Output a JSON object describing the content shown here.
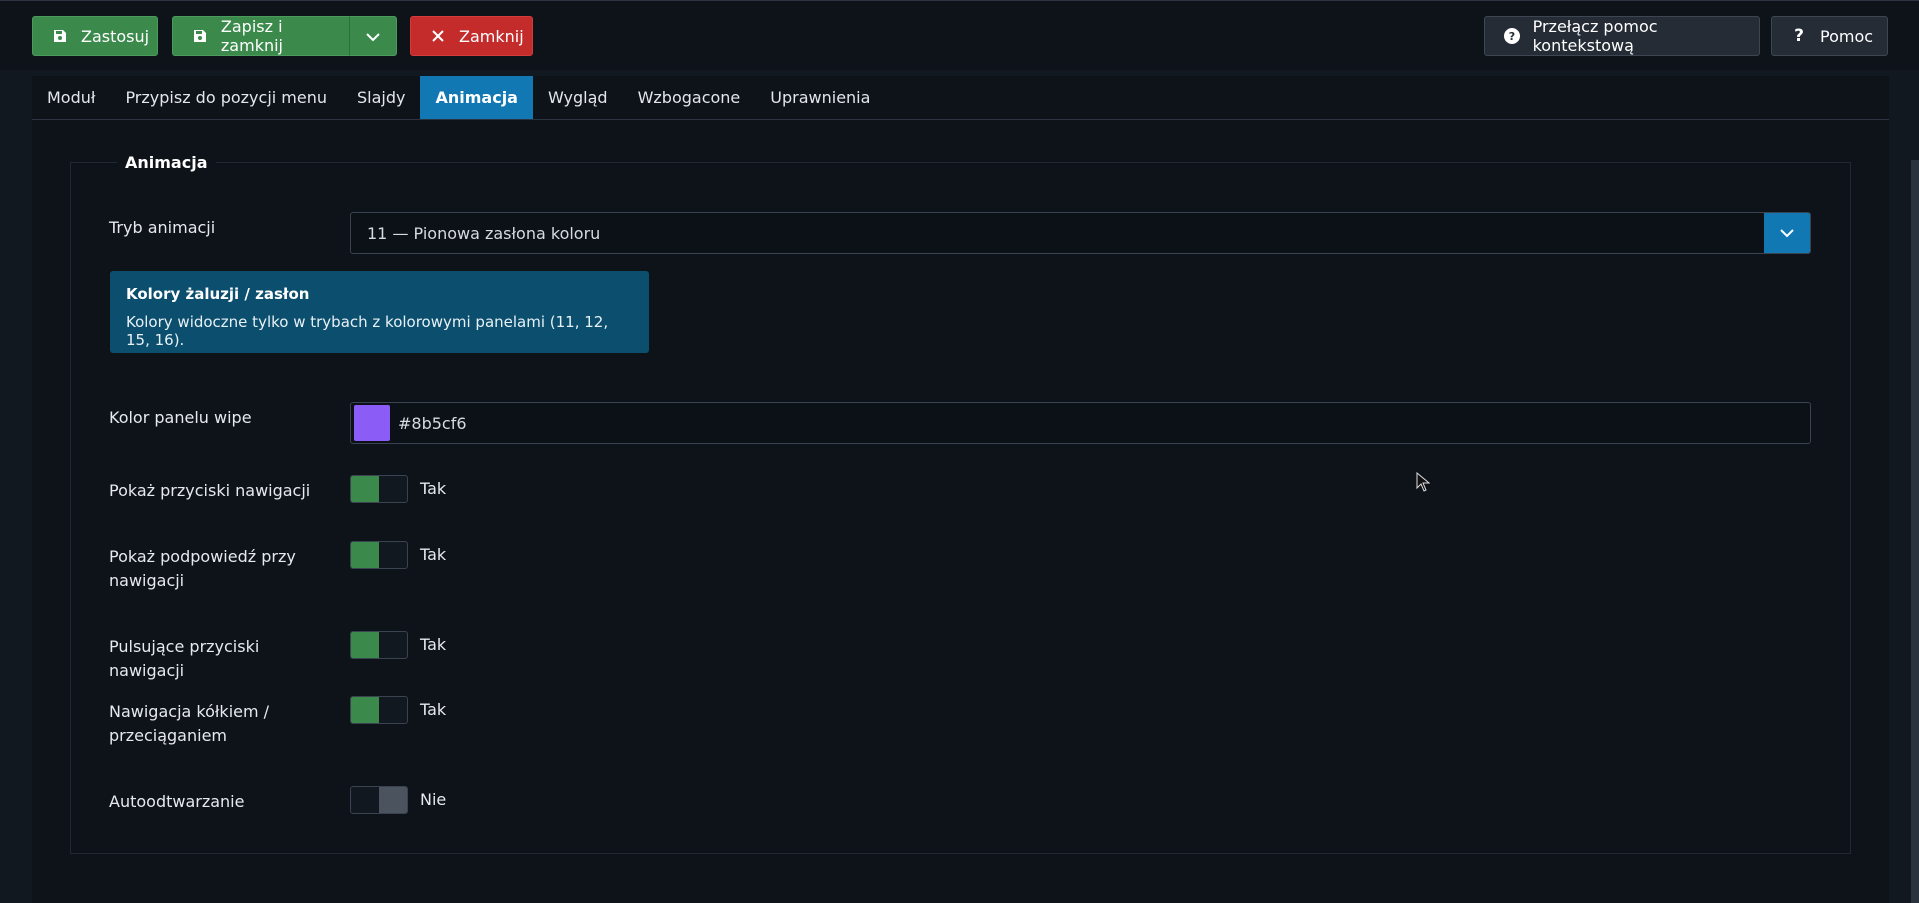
{
  "toolbar": {
    "apply_label": "Zastosuj",
    "save_close_label": "Zapisz i zamknij",
    "close_label": "Zamknij",
    "toggle_help_label": "Przełącz pomoc kontekstową",
    "help_label": "Pomoc"
  },
  "tabs": [
    {
      "label": "Moduł"
    },
    {
      "label": "Przypisz do pozycji menu"
    },
    {
      "label": "Slajdy"
    },
    {
      "label": "Animacja",
      "active": true
    },
    {
      "label": "Wygląd"
    },
    {
      "label": "Wzbogacone"
    },
    {
      "label": "Uprawnienia"
    }
  ],
  "fieldset": {
    "legend": "Animacja",
    "animation_mode": {
      "label": "Tryb animacji",
      "value": "11 — Pionowa zasłona koloru"
    },
    "alert": {
      "heading": "Kolory żaluzji / zasłon",
      "text": "Kolory widoczne tylko w trybach z kolorowymi panelami (11, 12, 15, 16)."
    },
    "wipe_color": {
      "label": "Kolor panelu wipe",
      "value": "#8b5cf6",
      "swatch": "#8b5cf6"
    },
    "switches": [
      {
        "label": "Pokaż przyciski nawigacji",
        "state": "Tak",
        "on": true
      },
      {
        "label": "Pokaż podpowiedź przy nawigacji",
        "state": "Tak",
        "on": true
      },
      {
        "label": "Pulsujące przyciski nawigacji",
        "state": "Tak",
        "on": true
      },
      {
        "label": "Nawigacja kółkiem / przeciąganiem",
        "state": "Tak",
        "on": true
      },
      {
        "label": "Autoodtwarzanie",
        "state": "Nie",
        "on": false
      }
    ]
  },
  "colors": {
    "success": "#3b8a4c",
    "danger": "#c42b2b",
    "primary": "#1178b3",
    "info_bg": "#0b4e6e"
  },
  "icons": {
    "apply": "save-icon",
    "save_close": "save-icon",
    "dropdown": "chevron-down-icon",
    "close": "close-icon",
    "toggle_help": "question-circle-icon",
    "help": "question-icon"
  }
}
